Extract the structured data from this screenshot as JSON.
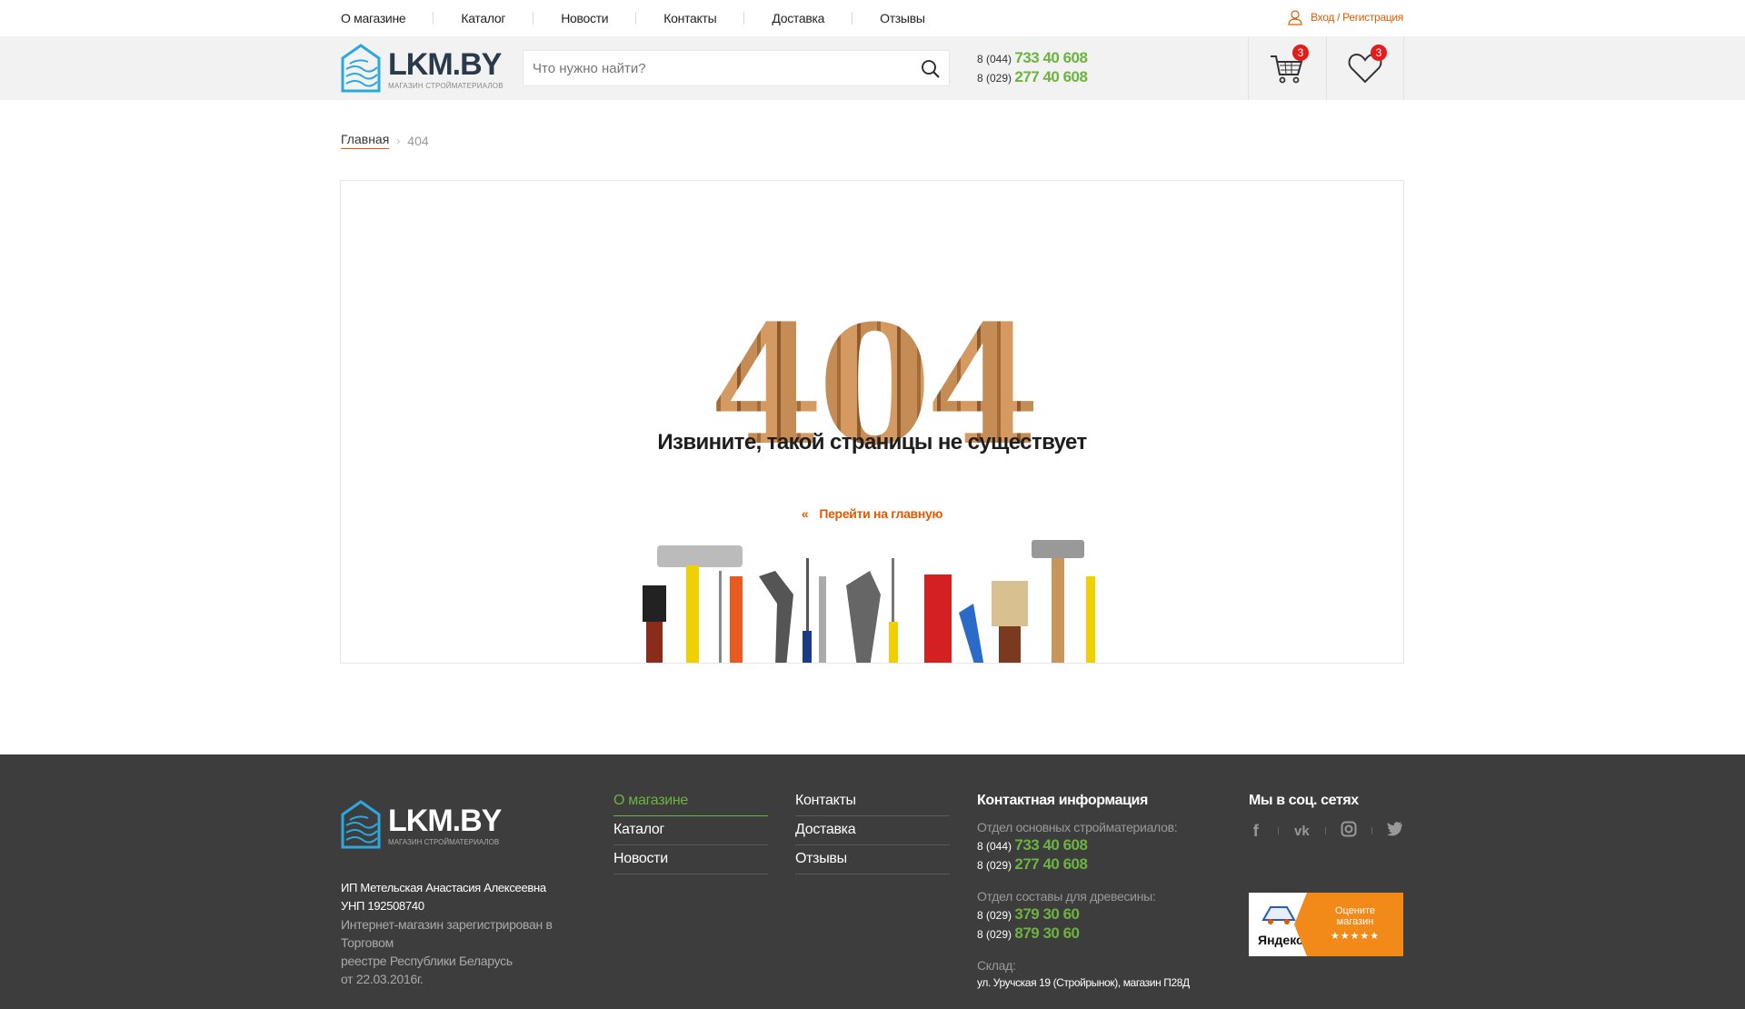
{
  "topnav": {
    "items": [
      "О магазине",
      "Каталог",
      "Новости",
      "Контакты",
      "Доставка",
      "Отзывы"
    ],
    "login": "Вход / Регистрация"
  },
  "header": {
    "logo_name": "LKM.BY",
    "logo_sub": "МАГАЗИН СТРОЙМАТЕРИАЛОВ",
    "search_placeholder": "Что нужно найти?",
    "phone1_prefix": "8 (044)",
    "phone1_number": "733 40 608",
    "phone2_prefix": "8 (029)",
    "phone2_number": "277 40 608",
    "cart_count": "3",
    "wishlist_count": "3"
  },
  "breadcrumb": {
    "home": "Главная",
    "current": "404"
  },
  "error": {
    "code": "404",
    "message": "Извините, такой страницы не существует",
    "link": "Перейти на главную"
  },
  "footer": {
    "logo_name": "LKM.BY",
    "logo_sub": "МАГАЗИН СТРОЙМАТЕРИАЛОВ",
    "owner": "ИП Метельская Анастасия Алексеевна",
    "unp": "УНП 192508740",
    "registry_line1": "Интернет-магазин зарегистрирован в Торговом",
    "registry_line2": "реестре Республики Беларусь",
    "registry_line3": "от 22.03.2016г.",
    "menu_col1": [
      "О магазине",
      "Каталог",
      "Новости"
    ],
    "menu_col2": [
      "Контакты",
      "Доставка",
      "Отзывы"
    ],
    "contact_title": "Контактная информация",
    "dept1_label": "Отдел основных стройматериалов:",
    "dept1_phone1_prefix": "8 (044)",
    "dept1_phone1_number": "733 40 608",
    "dept1_phone2_prefix": "8 (029)",
    "dept1_phone2_number": "277 40 608",
    "dept2_label": "Отдел составы для древесины:",
    "dept2_phone1_prefix": "8 (029)",
    "dept2_phone1_number": "379 30 60",
    "dept2_phone2_prefix": "8 (029)",
    "dept2_phone2_number": "879 30 60",
    "warehouse_label": "Склад:",
    "warehouse_address": "ул. Уручская 19 (Стройрынок), магазин П28Д",
    "social_title": "Мы в соц. сетях",
    "yandex_brand": "Яндекс",
    "yandex_rate_line1": "Оцените",
    "yandex_rate_line2": "магазин",
    "yandex_stars": "★★★★★"
  },
  "colors": {
    "accent_orange": "#e05a00",
    "phone_green": "#6cb33f",
    "badge_red": "#e41c1c",
    "footer_bg": "#3d3d3d",
    "header_bg": "#f2f2f2",
    "logo_blue": "#2aa9e0"
  }
}
